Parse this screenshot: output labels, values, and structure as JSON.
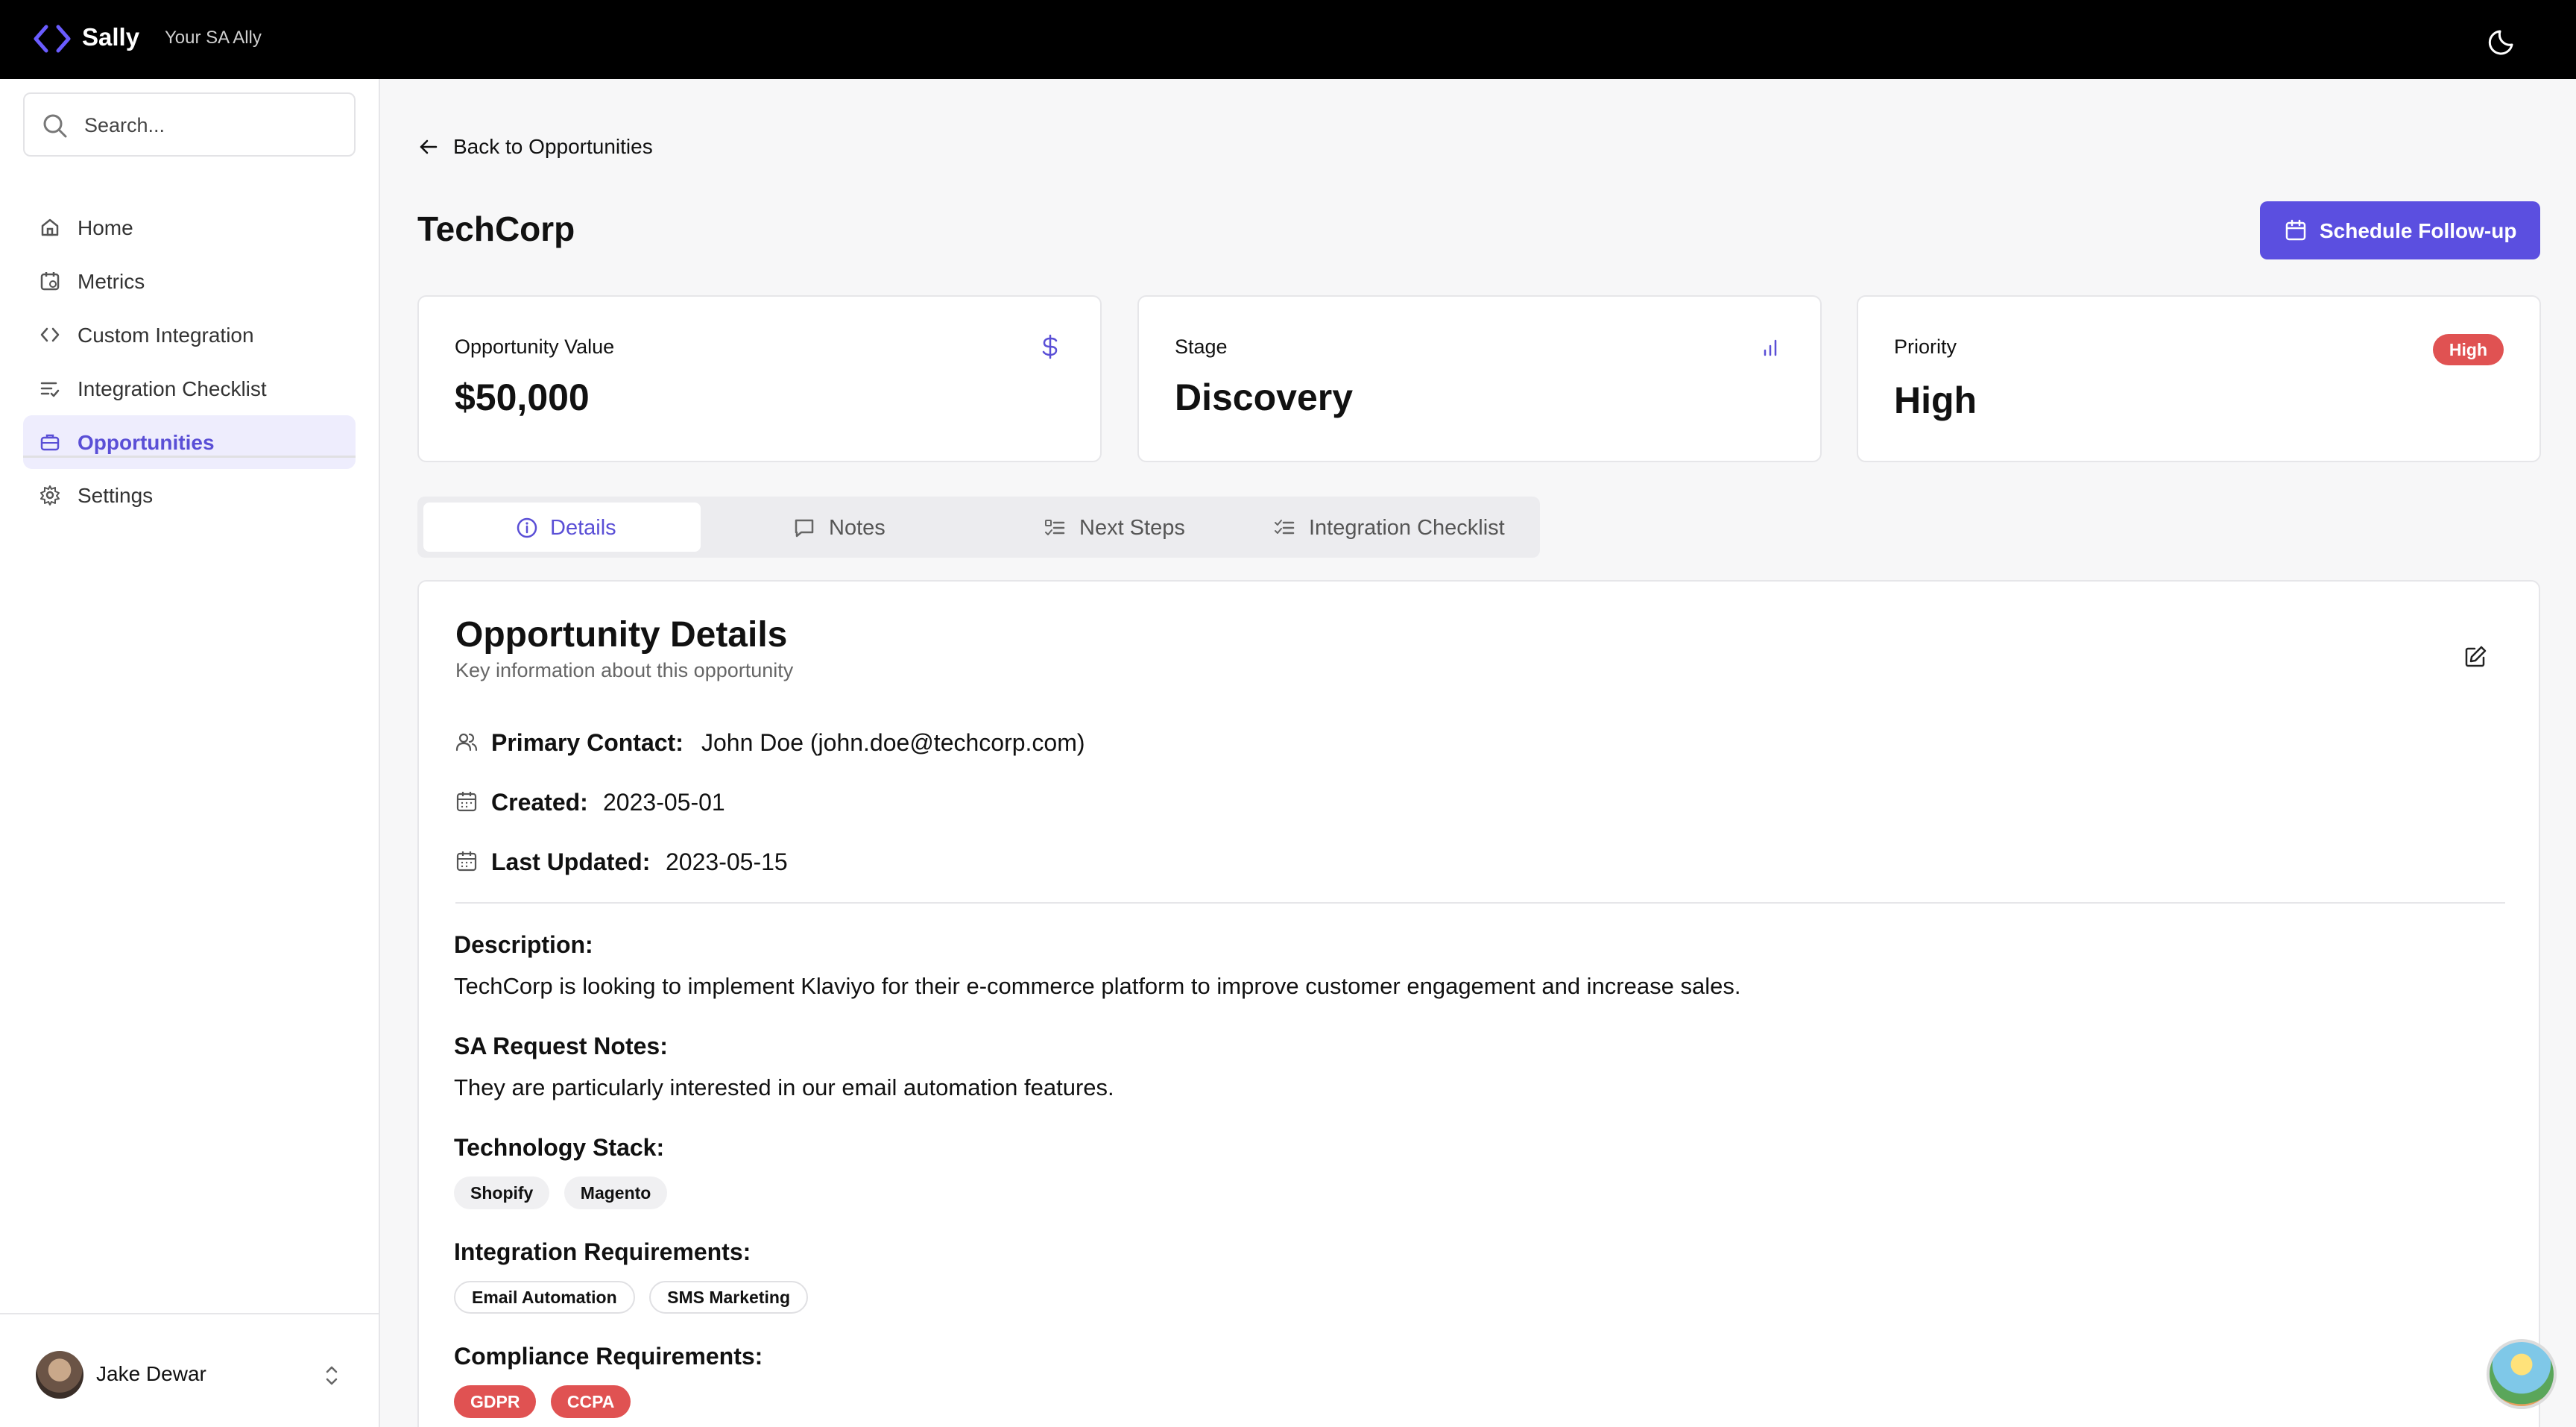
{
  "app": {
    "name": "Sally",
    "tagline": "Your SA Ally",
    "theme_toggle_icon": "moon-icon"
  },
  "sidebar": {
    "search_placeholder": "Search...",
    "items": [
      {
        "label": "Home",
        "icon": "home-icon"
      },
      {
        "label": "Metrics",
        "icon": "calendar-chart-icon"
      },
      {
        "label": "Custom Integration",
        "icon": "code-icon"
      },
      {
        "label": "Integration Checklist",
        "icon": "list-check-icon"
      },
      {
        "label": "Opportunities",
        "icon": "briefcase-icon",
        "active": true
      }
    ],
    "settings_label": "Settings",
    "user": {
      "name": "Jake Dewar"
    }
  },
  "page": {
    "back_label": "Back to Opportunities",
    "title": "TechCorp",
    "action_label": "Schedule Follow-up"
  },
  "stats": {
    "value": {
      "label": "Opportunity Value",
      "value": "$50,000"
    },
    "stage": {
      "label": "Stage",
      "value": "Discovery"
    },
    "priority": {
      "label": "Priority",
      "value": "High",
      "badge": "High"
    }
  },
  "tabs": [
    {
      "label": "Details",
      "active": true
    },
    {
      "label": "Notes"
    },
    {
      "label": "Next Steps"
    },
    {
      "label": "Integration Checklist"
    }
  ],
  "details": {
    "title": "Opportunity Details",
    "subtitle": "Key information about this opportunity",
    "primary_contact_label": "Primary Contact:",
    "primary_contact_value": "John Doe (john.doe@techcorp.com)",
    "created_label": "Created:",
    "created_value": "2023-05-01",
    "updated_label": "Last Updated:",
    "updated_value": "2023-05-15",
    "description_label": "Description:",
    "description": "TechCorp is looking to implement Klaviyo for their e-commerce platform to improve customer engagement and increase sales.",
    "sa_notes_label": "SA Request Notes:",
    "sa_notes": "They are particularly interested in our email automation features.",
    "tech_stack_label": "Technology Stack:",
    "tech_stack": [
      "Shopify",
      "Magento"
    ],
    "integration_label": "Integration Requirements:",
    "integration": [
      "Email Automation",
      "SMS Marketing"
    ],
    "compliance_label": "Compliance Requirements:",
    "compliance": [
      "GDPR",
      "CCPA"
    ]
  },
  "colors": {
    "accent": "#5b4fe0",
    "danger": "#e05252",
    "topbar": "#000000"
  }
}
